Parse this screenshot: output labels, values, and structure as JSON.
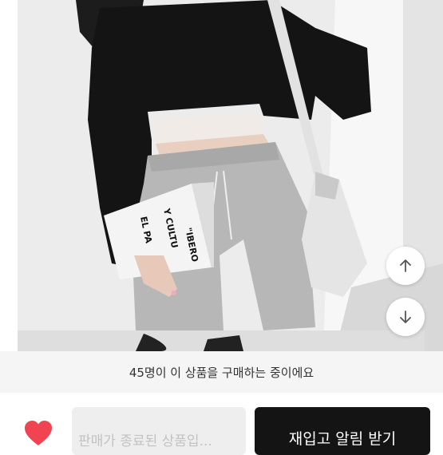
{
  "product": {
    "image_alt": "product photo",
    "book_text_1": "\"IBERO",
    "book_text_2": "Y CULTU",
    "book_text_3": "EL PA"
  },
  "notice": {
    "text": "45명이 이 상품을 구매하는 중이에요"
  },
  "bottom_bar": {
    "ended_text": "판매가 종료된 상품입...",
    "restock_label": "재입고 알림 받기",
    "heart_color": "#f04452"
  },
  "icons": {
    "scroll_up": "arrow-up-icon",
    "scroll_down": "arrow-down-icon",
    "like": "heart-icon"
  }
}
